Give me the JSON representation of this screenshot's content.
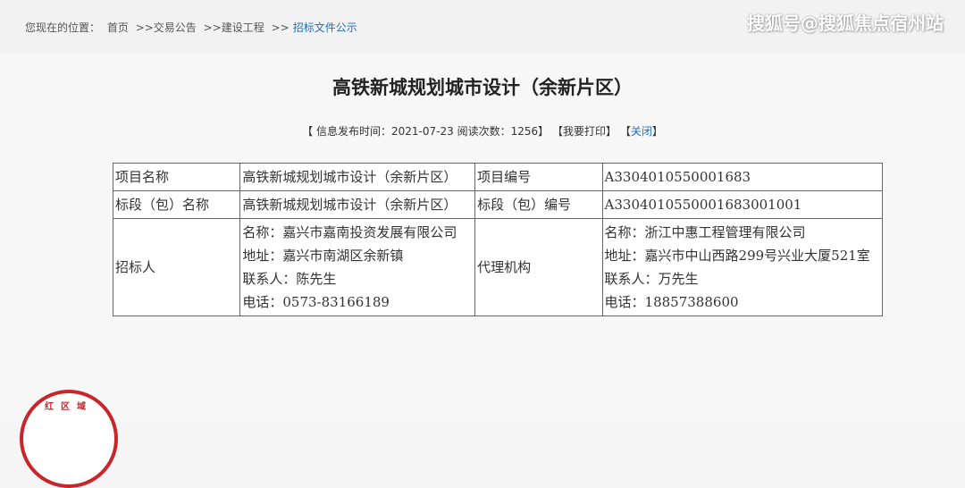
{
  "breadcrumb": {
    "prefix": "您现在的位置：",
    "items": [
      "首页",
      ">>交易公告",
      ">>建设工程",
      ">>",
      "招标文件公示"
    ]
  },
  "watermark": "搜狐号@搜狐焦点宿州站",
  "page_title": "高铁新城规划城市设计（余新片区）",
  "meta": {
    "open_bracket": "【",
    "publish_label": "信息发布时间：",
    "publish_date": "2021-07-23",
    "views_label": "阅读次数：",
    "views": "1256",
    "close_bracket": "】",
    "print": "【我要打印】",
    "close_open": "【",
    "close_label": "关闭",
    "close_end": "】"
  },
  "table": {
    "row1": {
      "label1": "项目名称",
      "value1": "高铁新城规划城市设计（余新片区）",
      "label2": "项目编号",
      "value2": "A3304010550001683"
    },
    "row2": {
      "label1": "标段（包）名称",
      "value1": "高铁新城规划城市设计（余新片区）",
      "label2": "标段（包）编号",
      "value2": "A3304010550001683001001"
    },
    "row3": {
      "label1": "招标人",
      "tenderer": {
        "name": "名称：嘉兴市嘉南投资发展有限公司",
        "address": "地址：嘉兴市南湖区余新镇",
        "contact": "联系人：陈先生",
        "phone": "电话：0573-83166189"
      },
      "label2": "代理机构",
      "agency": {
        "name": "名称：浙江中惠工程管理有限公司",
        "address": "地址：嘉兴市中山西路299号兴业大厦521室",
        "contact": "联系人：万先生",
        "phone": "电话：18857388600"
      }
    }
  },
  "logo_text": "红区域",
  "colors": {
    "link_blue": "#1a6fc4",
    "seal_red": "#c8262b",
    "table_border": "#666666"
  }
}
